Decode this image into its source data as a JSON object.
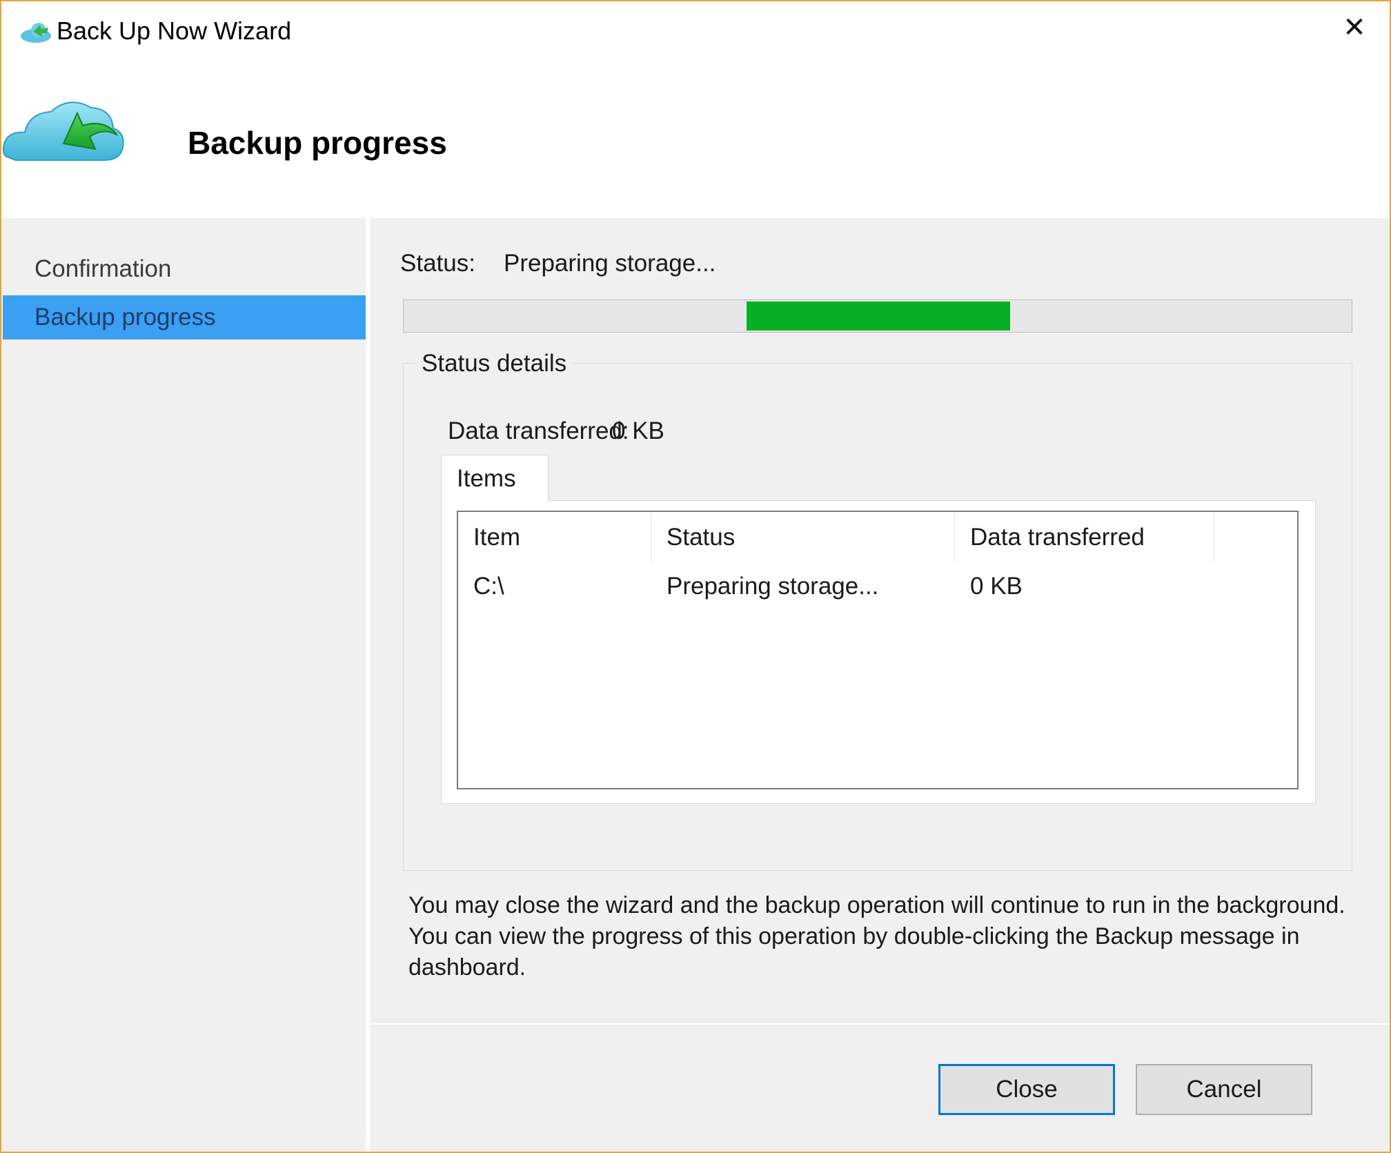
{
  "window": {
    "title": "Back Up Now Wizard",
    "close_glyph": "✕",
    "accent_border": "#e8a33c"
  },
  "header": {
    "title": "Backup progress",
    "icon": "cloud-backup-icon"
  },
  "sidebar": {
    "items": [
      {
        "label": "Confirmation",
        "active": false
      },
      {
        "label": "Backup progress",
        "active": true
      }
    ],
    "active_color": "#3b9ff2"
  },
  "main": {
    "status_label": "Status:",
    "status_value": "Preparing storage...",
    "progress": {
      "fill_start": 0.362,
      "fill_end": 0.64,
      "color": "#06b025"
    },
    "status_details": {
      "title": "Status details",
      "data_transferred_label": "Data transferred:",
      "data_transferred_value": "0 KB",
      "tab_label": "Items",
      "columns": [
        "Item",
        "Status",
        "Data transferred"
      ],
      "rows": [
        {
          "item": "C:\\",
          "status": "Preparing storage...",
          "data": "0 KB"
        }
      ]
    },
    "note": "You may close the wizard and the backup operation will continue to run in the background. You can view the progress of this operation by double-clicking the Backup message in dashboard."
  },
  "buttons": {
    "close": "Close",
    "cancel": "Cancel"
  }
}
